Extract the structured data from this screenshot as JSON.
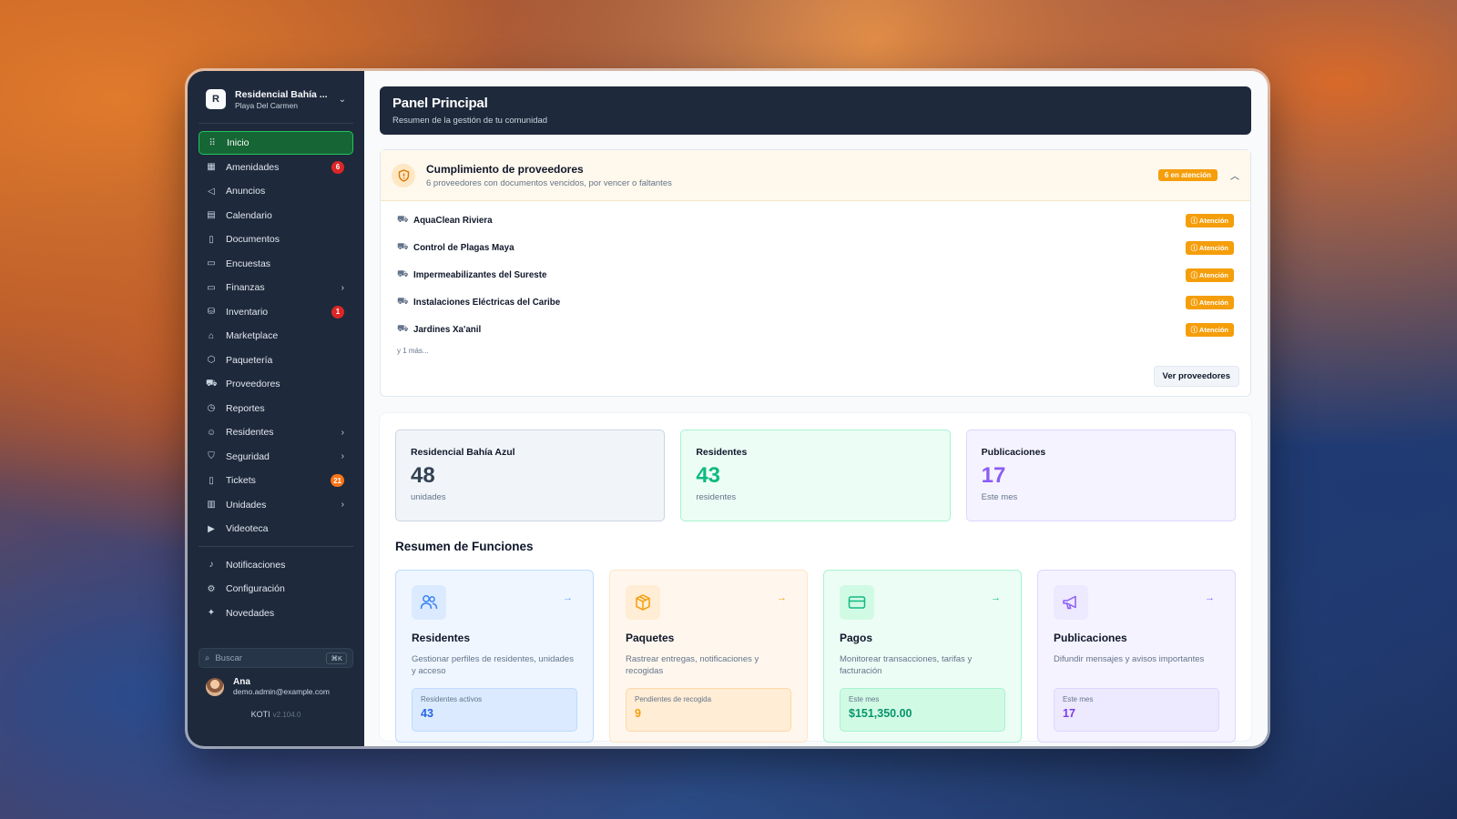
{
  "sidebar": {
    "org": {
      "logo": "R",
      "name": "Residencial Bahía ...",
      "city": "Playa Del Carmen",
      "chevron_icon": "chevron-down-icon"
    },
    "items": [
      {
        "label": "Inicio",
        "icon": "grid-icon",
        "active": true
      },
      {
        "label": "Amenidades",
        "icon": "building-icon",
        "badge": "6"
      },
      {
        "label": "Anuncios",
        "icon": "megaphone-icon"
      },
      {
        "label": "Calendario",
        "icon": "calendar-icon"
      },
      {
        "label": "Documentos",
        "icon": "file-icon"
      },
      {
        "label": "Encuestas",
        "icon": "poll-icon"
      },
      {
        "label": "Finanzas",
        "icon": "wallet-icon",
        "chevron": true
      },
      {
        "label": "Inventario",
        "icon": "boxes-icon",
        "badge": "1"
      },
      {
        "label": "Marketplace",
        "icon": "store-icon"
      },
      {
        "label": "Paquetería",
        "icon": "package-icon"
      },
      {
        "label": "Proveedores",
        "icon": "truck-icon"
      },
      {
        "label": "Reportes",
        "icon": "clock-icon"
      },
      {
        "label": "Residentes",
        "icon": "users-icon",
        "chevron": true
      },
      {
        "label": "Seguridad",
        "icon": "shield-icon",
        "chevron": true
      },
      {
        "label": "Tickets",
        "icon": "ticket-icon",
        "badge": "21"
      },
      {
        "label": "Unidades",
        "icon": "building2-icon",
        "chevron": true
      },
      {
        "label": "Videoteca",
        "icon": "video-icon"
      }
    ],
    "secondary": [
      {
        "label": "Notificaciones",
        "icon": "bell-icon"
      },
      {
        "label": "Configuración",
        "icon": "gear-icon"
      },
      {
        "label": "Novedades",
        "icon": "sparkles-icon"
      }
    ],
    "search": {
      "placeholder": "Buscar",
      "shortcut": "⌘K"
    },
    "user": {
      "name": "Ana",
      "email": "demo.admin@example.com"
    },
    "app": {
      "name": "KOTI",
      "version": "v2.104.0"
    }
  },
  "header": {
    "title": "Panel Principal",
    "subtitle": "Resumen de la gestión de tu comunidad"
  },
  "compliance": {
    "title": "Cumplimiento de proveedores",
    "subtitle": "6 proveedores con documentos vencidos, por vencer o faltantes",
    "badge": "6 en atención",
    "vendors": [
      {
        "name": "AquaClean Riviera",
        "status": "Atención"
      },
      {
        "name": "Control de Plagas Maya",
        "status": "Atención"
      },
      {
        "name": "Impermeabilizantes del Sureste",
        "status": "Atención"
      },
      {
        "name": "Instalaciones Eléctricas del Caribe",
        "status": "Atención"
      },
      {
        "name": "Jardines Xa'anil",
        "status": "Atención"
      }
    ],
    "more": "y 1 más...",
    "button": "Ver proveedores"
  },
  "stats": [
    {
      "title": "Residencial Bahía Azul",
      "value": "48",
      "sub": "unidades"
    },
    {
      "title": "Residentes",
      "value": "43",
      "sub": "residentes"
    },
    {
      "title": "Publicaciones",
      "value": "17",
      "sub": "Este mes"
    }
  ],
  "features": {
    "title": "Resumen de Funciones",
    "cards": [
      {
        "title": "Residentes",
        "desc": "Gestionar perfiles de residentes, unidades y acceso",
        "box_label": "Residentes activos",
        "box_value": "43",
        "icon": "users-icon"
      },
      {
        "title": "Paquetes",
        "desc": "Rastrear entregas, notificaciones y recogidas",
        "box_label": "Pendientes de recogida",
        "box_value": "9",
        "icon": "package-icon"
      },
      {
        "title": "Pagos",
        "desc": "Monitorear transacciones, tarifas y facturación",
        "box_label": "Este mes",
        "box_value": "$151,350.00",
        "icon": "credit-card-icon"
      },
      {
        "title": "Publicaciones",
        "desc": "Difundir mensajes y avisos importantes",
        "box_label": "Este mes",
        "box_value": "17",
        "icon": "megaphone-icon"
      }
    ]
  },
  "colors": {
    "sidebar_bg": "#1e293b",
    "active_green": "#166534",
    "warning": "#f59e0b",
    "badge_red": "#dc2626"
  }
}
